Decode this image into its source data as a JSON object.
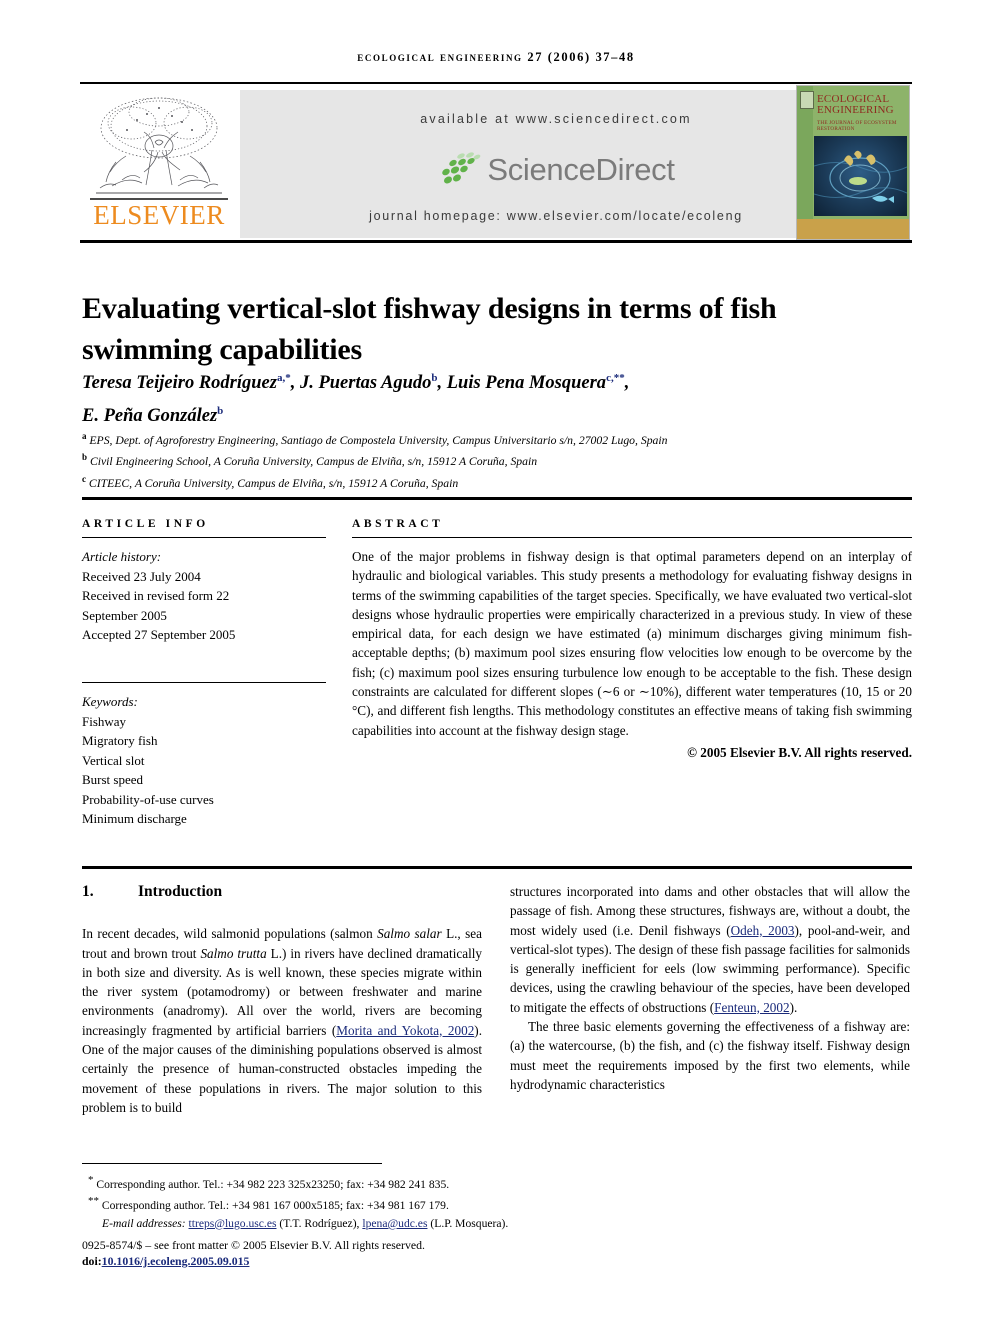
{
  "running_head": "ECOLOGICAL ENGINEERING 27 (2006) 37–48",
  "header": {
    "elsevier_wordmark": "ELSEVIER",
    "available_at": "available at www.sciencedirect.com",
    "sciencedirect_word": "ScienceDirect",
    "journal_homepage": "journal homepage: www.elsevier.com/locate/ecoleng",
    "cover": {
      "title_line1": "ECOLOGICAL",
      "title_line2": "ENGINEERING",
      "subtitle": "THE JOURNAL OF ECOSYSTEM RESTORATION"
    },
    "colors": {
      "elsevier_orange": "#ED8B1F",
      "sciencedirect_green": "#61b24a",
      "sciencedirect_gray": "#7b7b7b",
      "panel_gray": "#e6e6e6",
      "cover_green": "#8db36a",
      "cover_maroon": "#8e2b20",
      "link_blue": "#1a2a7a"
    }
  },
  "article": {
    "title": "Evaluating vertical-slot fishway designs in terms of fish swimming capabilities",
    "authors_line1_a": "Teresa Teijeiro Rodríguez",
    "authors_sup_a": "a,*",
    "authors_line1_b": ", J. Puertas Agudo",
    "authors_sup_b": "b",
    "authors_line1_c": ", Luis Pena Mosquera",
    "authors_sup_c": "c,**",
    "authors_line1_end": ",",
    "authors_line2": "E. Peña González",
    "authors_sup_d": "b",
    "affiliations": [
      {
        "mark": "a",
        "text": "EPS, Dept. of Agroforestry Engineering, Santiago de Compostela University, Campus Universitario s/n, 27002 Lugo, Spain"
      },
      {
        "mark": "b",
        "text": "Civil Engineering School, A Coruña University, Campus de Elviña, s/n, 15912 A Coruña, Spain"
      },
      {
        "mark": "c",
        "text": "CITEEC, A Coruña University, Campus de Elviña, s/n, 15912 A Coruña, Spain"
      }
    ]
  },
  "article_info": {
    "heading": "ARTICLE INFO",
    "history_label": "Article history:",
    "history": [
      "Received 23 July 2004",
      "Received in revised form 22",
      "September 2005",
      "Accepted 27 September 2005"
    ],
    "keywords_label": "Keywords:",
    "keywords": [
      "Fishway",
      "Migratory fish",
      "Vertical slot",
      "Burst speed",
      "Probability-of-use curves",
      "Minimum discharge"
    ]
  },
  "abstract": {
    "heading": "ABSTRACT",
    "body": "One of the major problems in fishway design is that optimal parameters depend on an interplay of hydraulic and biological variables. This study presents a methodology for evaluating fishway designs in terms of the swimming capabilities of the target species. Specifically, we have evaluated two vertical-slot designs whose hydraulic properties were empirically characterized in a previous study. In view of these empirical data, for each design we have estimated (a) minimum discharges giving minimum fish-acceptable depths; (b) maximum pool sizes ensuring flow velocities low enough to be overcome by the fish; (c) maximum pool sizes ensuring turbulence low enough to be acceptable to the fish. These design constraints are calculated for different slopes (∼6 or ∼10%), different water temperatures (10, 15 or 20 °C), and different fish lengths. This methodology constitutes an effective means of taking fish swimming capabilities into account at the fishway design stage.",
    "copyright": "© 2005 Elsevier B.V. All rights reserved."
  },
  "introduction": {
    "number": "1.",
    "heading": "Introduction",
    "left_p1_part1": "In recent decades, wild salmonid populations (salmon ",
    "left_p1_ital1": "Salmo salar",
    "left_p1_part2": " L., sea trout and brown trout ",
    "left_p1_ital2": "Salmo trutta",
    "left_p1_part3": " L.) in rivers have declined dramatically in both size and diversity. As is well known, these species migrate within the river system (potamodromy) or between freshwater and marine environments (anadromy). All over the world, rivers are becoming increasingly fragmented by artificial barriers (",
    "left_p1_cite1": "Morita and Yokota, 2002",
    "left_p1_part4": "). One of the major causes of the diminishing populations observed is almost certainly the presence of human-constructed obstacles impeding the movement of these populations in rivers. The major solution to this problem is to build",
    "right_p1_part1": "structures incorporated into dams and other obstacles that will allow the passage of fish. Among these structures, fishways are, without a doubt, the most widely used (i.e. Denil fishways (",
    "right_p1_cite1": "Odeh, 2003",
    "right_p1_part2": "), pool-and-weir, and vertical-slot types). The design of these fish passage facilities for salmonids is generally inefficient for eels (low swimming performance). Specific devices, using the crawling behaviour of the species, have been developed to mitigate the effects of obstructions (",
    "right_p1_cite2": "Fenteun, 2002",
    "right_p1_part3": ").",
    "right_p2": "The three basic elements governing the effectiveness of a fishway are: (a) the watercourse, (b) the fish, and (c) the fishway itself. Fishway design must meet the requirements imposed by the first two elements, while hydrodynamic characteristics"
  },
  "footnotes": {
    "fn1_mark": "*",
    "fn1_text": "Corresponding author. Tel.: +34 982 223 325x23250; fax: +34 982 241 835.",
    "fn2_mark": "**",
    "fn2_text": "Corresponding author. Tel.: +34 981 167 000x5185; fax: +34 981 167 179.",
    "email_label": "E-mail addresses:",
    "email1": "ttreps@lugo.usc.es",
    "email1_owner": "(T.T. Rodríguez),",
    "email2": "lpena@udc.es",
    "email2_owner": "(L.P. Mosquera).",
    "frontmatter": "0925-8574/$ – see front matter © 2005 Elsevier B.V. All rights reserved.",
    "doi_label": "doi:",
    "doi_value": "10.1016/j.ecoleng.2005.09.015"
  }
}
